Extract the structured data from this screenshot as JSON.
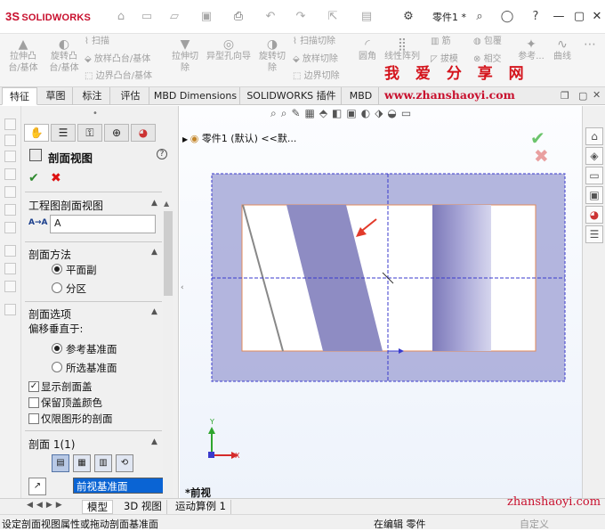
{
  "titlebar": {
    "logo_mark": "3S",
    "logo_text": "SOLIDWORKS",
    "document_title": "零件1 *",
    "icons": [
      "home-icon",
      "new-file-icon",
      "open-folder-icon",
      "save-icon",
      "print-icon",
      "undo-icon",
      "redo-icon",
      "select-arrow-icon",
      "rebuild-icon",
      "options-gear-icon",
      "search-icon",
      "user-icon",
      "help-icon"
    ]
  },
  "ribbon": {
    "buttons": [
      {
        "label": "拉伸凸\n台/基体"
      },
      {
        "label": "旋转凸\n台/基体"
      },
      {
        "label": "扫描"
      },
      {
        "label": "放样凸台/基体"
      },
      {
        "label": "边界凸台/基体"
      },
      {
        "label": "拉伸切\n除"
      },
      {
        "label": "异型孔向导"
      },
      {
        "label": "旋转切\n除"
      },
      {
        "label": "扫描切除"
      },
      {
        "label": "放样切除"
      },
      {
        "label": "边界切除"
      },
      {
        "label": "圆角"
      },
      {
        "label": "线性阵列"
      },
      {
        "label": "筋"
      },
      {
        "label": "拔模"
      },
      {
        "label": "包覆"
      },
      {
        "label": "相交"
      },
      {
        "label": "参考..."
      },
      {
        "label": "曲线"
      }
    ]
  },
  "watermark": {
    "title": "我 爱 分 享 网",
    "url": "www.zhanshaoyi.com",
    "footer_url": "zhanshaoyi.com"
  },
  "tabs": [
    {
      "label": "特征",
      "active": true
    },
    {
      "label": "草图"
    },
    {
      "label": "标注"
    },
    {
      "label": "评估"
    },
    {
      "label": "MBD Dimensions"
    },
    {
      "label": "SOLIDWORKS 插件"
    },
    {
      "label": "MBD"
    }
  ],
  "panel": {
    "title": "剖面视图",
    "ok": "✔",
    "cancel": "✖",
    "help": "?",
    "group_label": {
      "title": "工程图剖面视图",
      "label_prefix": "A→A",
      "value": "A"
    },
    "group_method": {
      "title": "剖面方法",
      "options": [
        {
          "label": "平面副",
          "selected": true
        },
        {
          "label": "分区",
          "selected": false
        }
      ]
    },
    "group_options": {
      "title": "剖面选项",
      "offset_label": "偏移垂直于:",
      "options": [
        {
          "label": "参考基准面",
          "selected": true
        },
        {
          "label": "所选基准面",
          "selected": false
        }
      ],
      "checkboxes": [
        {
          "label": "显示剖面盖",
          "checked": true
        },
        {
          "label": "保留顶盖颜色",
          "checked": false
        },
        {
          "label": "仅限图形的剖面",
          "checked": false
        }
      ]
    },
    "group_section1": {
      "title": "剖面 1(1)",
      "plane_value": "前视基准面"
    }
  },
  "viewport": {
    "tree_label": "零件1 (默认) <<默...",
    "view_label": "*前视",
    "triad": {
      "x": "X",
      "y": "Y"
    },
    "colors": {
      "section_fill": "#8e8cc3",
      "box_fill": "#a7a9d8",
      "box_border": "#3a3acc",
      "part_outline": "#e08a5a",
      "arrow": "#e23a2a"
    }
  },
  "bottom_tabs": [
    {
      "label": "模型",
      "active": true
    },
    {
      "label": "3D 视图"
    },
    {
      "label": "运动算例 1"
    }
  ],
  "status": {
    "left": "设定剖面视图属性或拖动剖面基准面",
    "right": "在编辑 零件",
    "custom": "自定义"
  }
}
